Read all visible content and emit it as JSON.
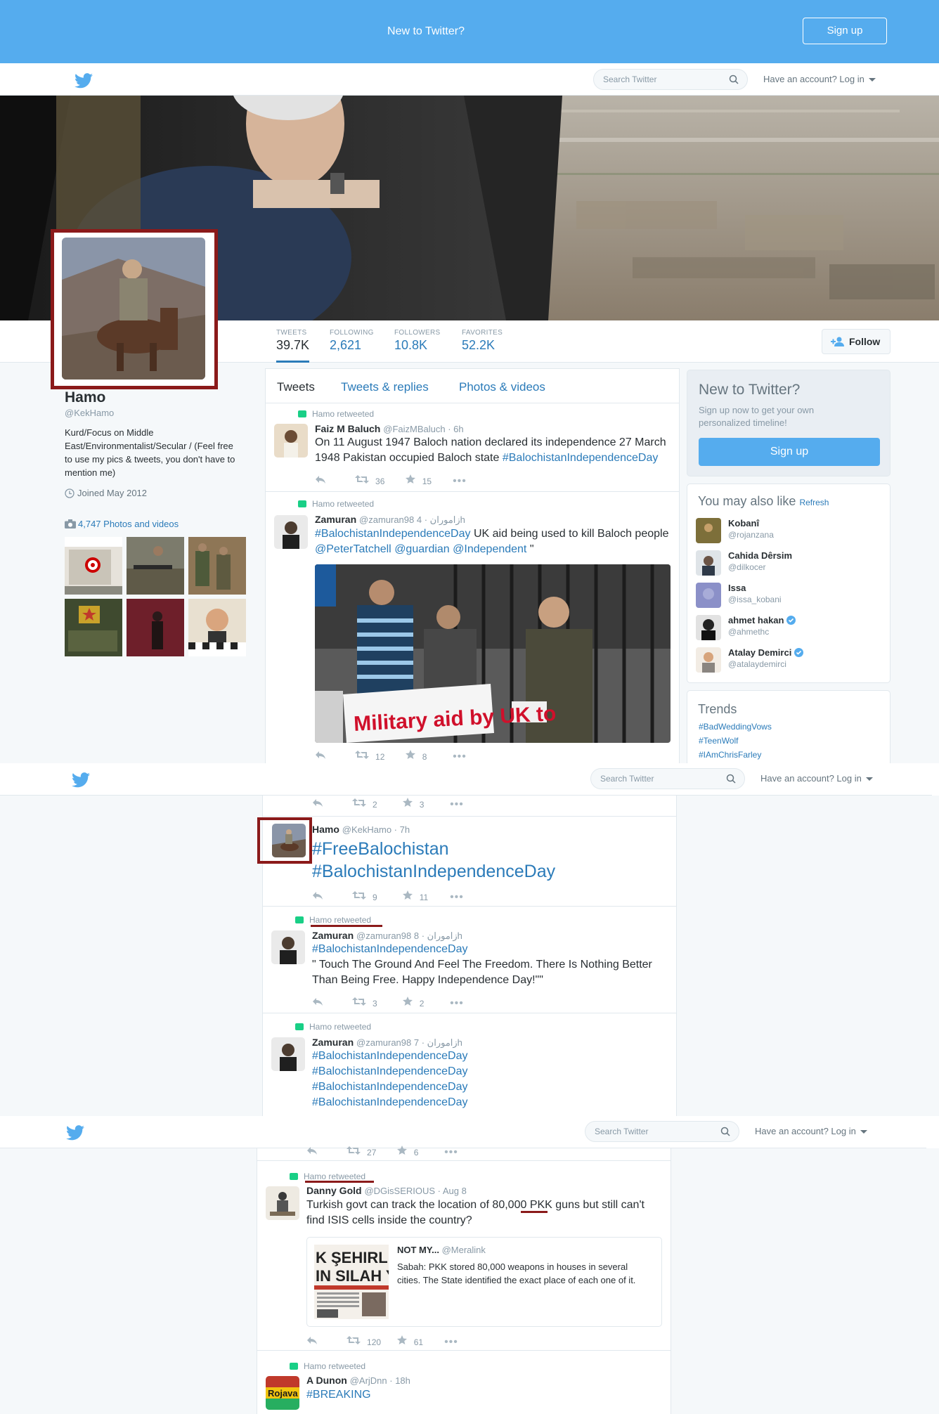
{
  "banner": {
    "text": "New to Twitter?",
    "signup": "Sign up"
  },
  "topbar": {
    "search_placeholder": "Search Twitter",
    "login": "Have an account? Log in"
  },
  "stats": [
    {
      "label": "TWEETS",
      "value": "39.7K"
    },
    {
      "label": "FOLLOWING",
      "value": "2,621"
    },
    {
      "label": "FOLLOWERS",
      "value": "10.8K"
    },
    {
      "label": "FAVORITES",
      "value": "52.2K"
    }
  ],
  "follow_label": "Follow",
  "profile": {
    "name": "Hamo",
    "handle": "@KekHamo",
    "bio": "Kurd/Focus on Middle East/Environmentalist/Secular / (Feel free to use my pics & tweets, you don't have to mention me)",
    "joined": "Joined May 2012",
    "photos": "4,747 Photos and videos"
  },
  "tabs": [
    "Tweets",
    "Tweets & replies",
    "Photos & videos"
  ],
  "tweets": [
    {
      "rt": "Hamo retweeted",
      "name": "Faiz M Baluch",
      "handle": "@FaizMBaluch · 6h",
      "text": "On 11 August 1947 Baloch nation declared its independence 27 March 1948 Pakistan occupied Baloch state",
      "tag": "#BalochistanIndependenceDay",
      "retweets": "36",
      "favorites": "15"
    },
    {
      "rt": "Hamo retweeted",
      "name": "Zamuran",
      "handle": "@zamuran98 زاموران · 4h",
      "tag1": "#BalochistanIndependenceDay",
      "text1": " UK aid being used to kill Baloch people",
      "m1": "@PeterTatchell",
      "m2": "@guardian",
      "m3": "@Independent",
      "q": " \"",
      "image_text": "Military aid by UK to",
      "retweets": "12",
      "favorites": "8"
    },
    {
      "retweets": "2",
      "favorites": "3"
    },
    {
      "name": "Hamo",
      "handle": "@KekHamo · 7h",
      "tag1": "#FreeBalochistan",
      "tag2": "#BalochistanIndependenceDay",
      "retweets": "9",
      "favorites": "11"
    },
    {
      "rt": "Hamo retweeted",
      "name": "Zamuran",
      "handle": "@zamuran98 زاموران · 8h",
      "tag": "#BalochistanIndependenceDay",
      "text": "\" Touch The Ground And Feel The Freedom. There Is Nothing Better Than Being Free. Happy Independence Day!\"\"",
      "retweets": "3",
      "favorites": "2"
    },
    {
      "rt": "Hamo retweeted",
      "name": "Zamuran",
      "handle": "@zamuran98 زاموران · 7h",
      "tags": [
        "#BalochistanIndependenceDay",
        "#BalochistanIndependenceDay",
        "#BalochistanIndependenceDay",
        "#BalochistanIndependenceDay"
      ]
    },
    {
      "retweets": "27",
      "favorites": "6"
    },
    {
      "rt": "Hamo retweeted",
      "name": "Danny Gold",
      "handle": "@DGisSERIOUS · Aug 8",
      "text1": "Turkish govt can track the location of 80,000 ",
      "pkk": "PKK",
      "text2": " guns but still can't find ISIS cells inside the country?",
      "quote": {
        "name": "NOT MY...",
        "handle": "@Meralink",
        "text": "Sabah: PKK stored 80,000 weapons in houses in several cities. The State identified the exact place of each one of it.",
        "img_text": "K ŞEHIRLE\nIN SILAH YIĞ"
      },
      "retweets": "120",
      "favorites": "61"
    },
    {
      "rt": "Hamo retweeted",
      "name": "A Dunon",
      "handle": "@ArjDnn · 18h",
      "tag": "#BREAKING",
      "avatar_text": "Rojava"
    }
  ],
  "side": {
    "new_title": "New to Twitter?",
    "new_text": "Sign up now to get your own personalized timeline!",
    "new_btn": "Sign up",
    "wtf_title": "You may also like",
    "wtf_refresh": "Refresh",
    "wtf": [
      {
        "name": "Kobanî",
        "handle": "@rojanzana"
      },
      {
        "name": "Cahida Dêrsim",
        "handle": "@dilkocer"
      },
      {
        "name": "Issa",
        "handle": "@issa_kobani"
      },
      {
        "name": "ahmet hakan",
        "handle": "@ahmethc"
      },
      {
        "name": "Atalay Demirci",
        "handle": "@atalaydemirci"
      }
    ],
    "trends_title": "Trends",
    "trends": [
      "#BadWeddingVows",
      "#TeenWolf",
      "#IAmChrisFarley"
    ]
  },
  "colors": {
    "accent": "#2b7bb9",
    "banner": "#55acee",
    "highlight": "#8b1a1a",
    "retweet": "#19cf86"
  }
}
